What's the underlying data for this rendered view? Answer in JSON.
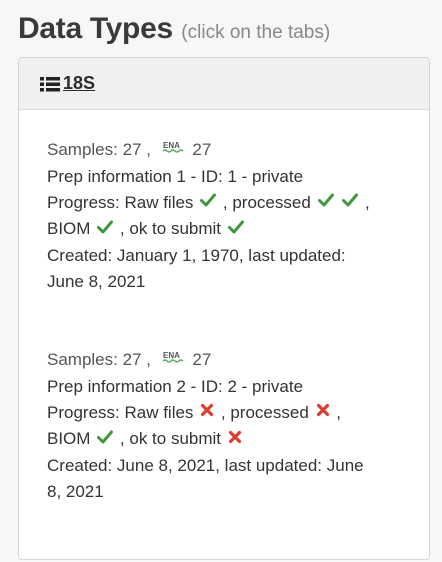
{
  "header": {
    "title": "Data Types",
    "subtitle": "(click on the tabs)"
  },
  "tab": {
    "icon": "list-icon",
    "label": "18S"
  },
  "entries": [
    {
      "samples_label": "Samples: 27 ,",
      "ena_label": "ENA",
      "ena_count": "27",
      "prep": "Prep information 1 - ID: 1 - private",
      "progress_label": "Progress: Raw files",
      "raw_files_status": "ok",
      "processed_label": ", processed",
      "processed_status": [
        "ok",
        "ok"
      ],
      "trailing_comma": ",",
      "biom_label": "BIOM",
      "biom_status": "ok",
      "submit_label": ", ok to submit",
      "submit_status": "ok",
      "created_l1": "Created: January 1, 1970, last updated:",
      "created_l2": "June 8, 2021"
    },
    {
      "samples_label": "Samples: 27 ,",
      "ena_label": "ENA",
      "ena_count": "27",
      "prep": "Prep information 2 - ID: 2 - private",
      "progress_label": "Progress: Raw files",
      "raw_files_status": "fail",
      "processed_label": ", processed",
      "processed_status": [
        "fail"
      ],
      "trailing_comma": ",",
      "biom_label": "BIOM",
      "biom_status": "ok",
      "submit_label": ", ok to submit",
      "submit_status": "fail",
      "created_l1": "Created: June 8, 2021, last updated: June",
      "created_l2": "8, 2021"
    }
  ],
  "colors": {
    "ok": "#3a9a3a",
    "fail": "#e03b2e",
    "ena_green": "#4caf50"
  }
}
